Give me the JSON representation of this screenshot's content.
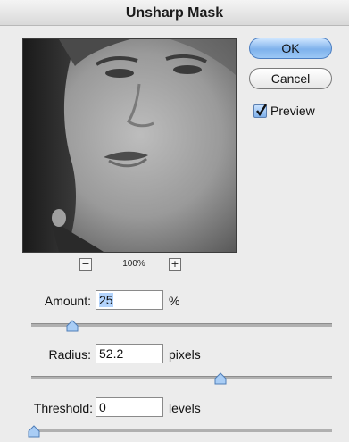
{
  "window": {
    "title": "Unsharp Mask"
  },
  "preview": {
    "zoom_level": "100%",
    "zoom_out_symbol": "−",
    "zoom_in_symbol": "+"
  },
  "buttons": {
    "ok": "OK",
    "cancel": "Cancel"
  },
  "preview_checkbox": {
    "label": "Preview",
    "checked": true
  },
  "amount": {
    "label": "Amount:",
    "value": "25",
    "unit": "%",
    "slider_fraction": 0.13
  },
  "radius": {
    "label": "Radius:",
    "value": "52.2",
    "unit": "pixels",
    "slider_fraction": 0.64
  },
  "threshold": {
    "label": "Threshold:",
    "value": "0",
    "unit": "levels",
    "slider_fraction": 0.0
  },
  "colors": {
    "ok_button": "#8fbcef",
    "selection": "#b3d4fd",
    "slider_thumb": "#a9cdf5"
  }
}
